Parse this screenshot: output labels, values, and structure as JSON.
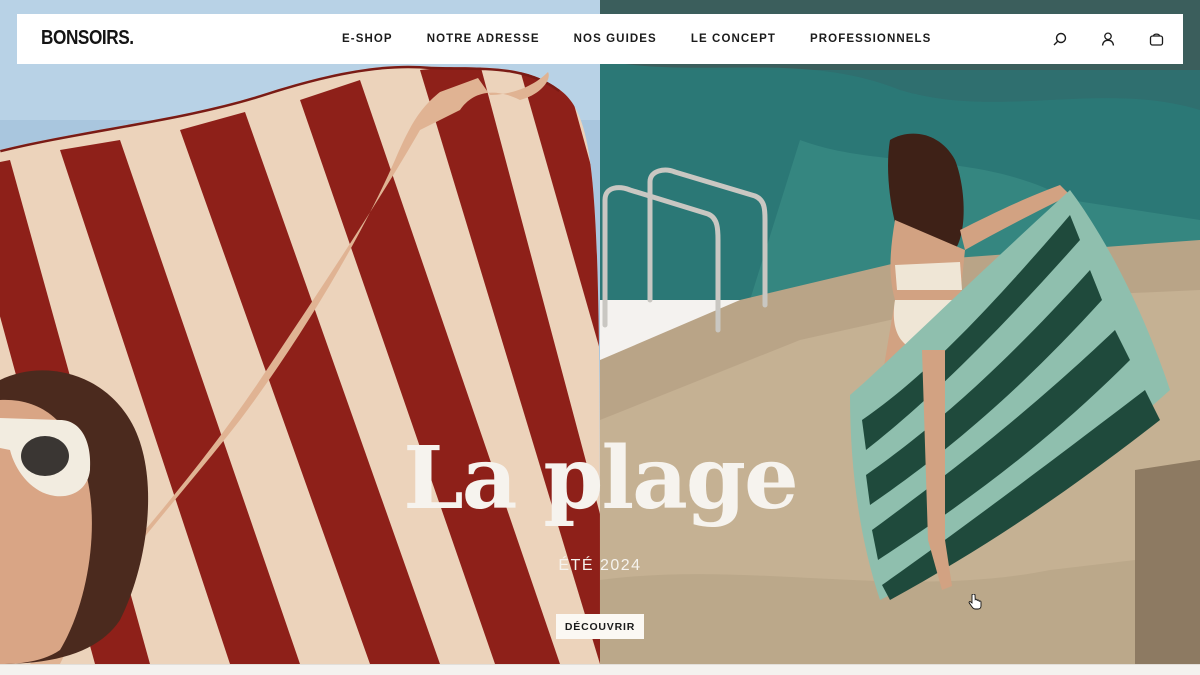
{
  "brand": {
    "logo": "BONSOIRS."
  },
  "nav": {
    "items": [
      {
        "label": "E-SHOP"
      },
      {
        "label": "NOTRE ADRESSE"
      },
      {
        "label": "NOS GUIDES"
      },
      {
        "label": "LE CONCEPT"
      },
      {
        "label": "PROFESSIONNELS"
      }
    ]
  },
  "header_icons": [
    "search-icon",
    "account-icon",
    "cart-icon"
  ],
  "hero": {
    "title": "La plage",
    "subtitle": "ÉTÉ 2024",
    "cta_label": "DÉCOUVRIR"
  },
  "colors": {
    "towel_red": "#8e2019",
    "towel_cream": "#ecd3bb",
    "sky": "#a9c6de",
    "sea": "#2f6f6f",
    "rock": "#b9a487",
    "towel_green": "#1f4a3c",
    "towel_mint": "#8fbfae",
    "text_light": "#f6f3ee"
  }
}
